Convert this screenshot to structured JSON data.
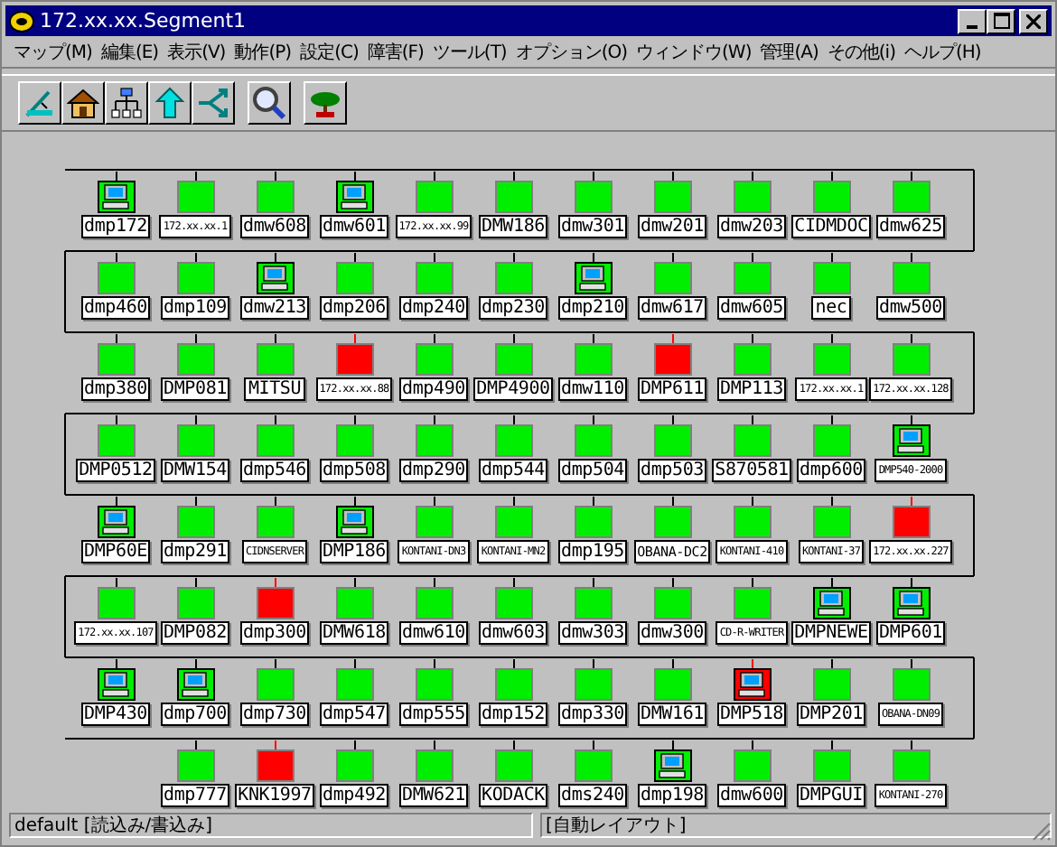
{
  "window": {
    "title": "172.xx.xx.Segment1"
  },
  "menu": [
    "マップ(M)",
    "編集(E)",
    "表示(V)",
    "動作(P)",
    "設定(C)",
    "障害(F)",
    "ツール(T)",
    "オプション(O)",
    "ウィンドウ(W)",
    "管理(A)",
    "その他(i)",
    "ヘルプ(H)"
  ],
  "toolbar": [
    {
      "kind": "draw"
    },
    {
      "kind": "home"
    },
    {
      "kind": "tree"
    },
    {
      "kind": "up"
    },
    {
      "kind": "route"
    },
    {
      "kind": "search",
      "group_gap": true
    },
    {
      "kind": "bonsai",
      "group_gap": true
    }
  ],
  "rows": [
    {
      "nodes": [
        {
          "name": "dmp172",
          "kind": "nt",
          "alarm": false
        },
        {
          "name": "172.xx.xx.1",
          "kind": "plain",
          "alarm": false
        },
        {
          "name": "dmw608",
          "kind": "plain",
          "alarm": false
        },
        {
          "name": "dmw601",
          "kind": "nt",
          "alarm": false
        },
        {
          "name": "172.xx.xx.99",
          "kind": "plain",
          "alarm": false
        },
        {
          "name": "DMW186",
          "kind": "plain",
          "alarm": false
        },
        {
          "name": "dmw301",
          "kind": "plain",
          "alarm": false
        },
        {
          "name": "dmw201",
          "kind": "plain",
          "alarm": false
        },
        {
          "name": "dmw203",
          "kind": "plain",
          "alarm": false
        },
        {
          "name": "CIDMDOC",
          "kind": "plain",
          "alarm": false
        },
        {
          "name": "dmw625",
          "kind": "plain",
          "alarm": false
        }
      ]
    },
    {
      "nodes": [
        {
          "name": "dmp460",
          "kind": "plain",
          "alarm": false
        },
        {
          "name": "dmp109",
          "kind": "plain",
          "alarm": false
        },
        {
          "name": "dmw213",
          "kind": "nt",
          "alarm": false
        },
        {
          "name": "dmp206",
          "kind": "plain",
          "alarm": false
        },
        {
          "name": "dmp240",
          "kind": "plain",
          "alarm": false
        },
        {
          "name": "dmp230",
          "kind": "plain",
          "alarm": false
        },
        {
          "name": "dmp210",
          "kind": "nt",
          "alarm": false
        },
        {
          "name": "dmw617",
          "kind": "plain",
          "alarm": false
        },
        {
          "name": "dmw605",
          "kind": "plain",
          "alarm": false
        },
        {
          "name": "nec",
          "kind": "plain",
          "alarm": false
        },
        {
          "name": "dmw500",
          "kind": "plain",
          "alarm": false
        }
      ]
    },
    {
      "nodes": [
        {
          "name": "dmp380",
          "kind": "plain",
          "alarm": false
        },
        {
          "name": "DMP081",
          "kind": "plain",
          "alarm": false
        },
        {
          "name": "MITSU",
          "kind": "plain",
          "alarm": false
        },
        {
          "name": "172.xx.xx.88",
          "kind": "plain",
          "alarm": true
        },
        {
          "name": "dmp490",
          "kind": "plain",
          "alarm": false
        },
        {
          "name": "DMP4900",
          "kind": "plain",
          "alarm": false
        },
        {
          "name": "dmw110",
          "kind": "plain",
          "alarm": false
        },
        {
          "name": "DMP611",
          "kind": "plain",
          "alarm": true
        },
        {
          "name": "DMP113",
          "kind": "plain",
          "alarm": false
        },
        {
          "name": "172.xx.xx.1",
          "kind": "plain",
          "alarm": false
        },
        {
          "name": "172.xx.xx.128",
          "kind": "plain",
          "alarm": false
        }
      ]
    },
    {
      "nodes": [
        {
          "name": "DMP0512",
          "kind": "plain",
          "alarm": false
        },
        {
          "name": "DMW154",
          "kind": "plain",
          "alarm": false
        },
        {
          "name": "dmp546",
          "kind": "plain",
          "alarm": false
        },
        {
          "name": "dmp508",
          "kind": "plain",
          "alarm": false
        },
        {
          "name": "dmp290",
          "kind": "plain",
          "alarm": false
        },
        {
          "name": "dmp544",
          "kind": "plain",
          "alarm": false
        },
        {
          "name": "dmp504",
          "kind": "plain",
          "alarm": false
        },
        {
          "name": "dmp503",
          "kind": "plain",
          "alarm": false
        },
        {
          "name": "S870581",
          "kind": "plain",
          "alarm": false
        },
        {
          "name": "dmp600",
          "kind": "plain",
          "alarm": false
        },
        {
          "name": "DMP540-2000",
          "kind": "nt",
          "alarm": false
        }
      ]
    },
    {
      "nodes": [
        {
          "name": "DMP60E",
          "kind": "nt",
          "alarm": false
        },
        {
          "name": "dmp291",
          "kind": "plain",
          "alarm": false
        },
        {
          "name": "CIDNSERVER",
          "kind": "plain",
          "alarm": false
        },
        {
          "name": "DMP186",
          "kind": "nt",
          "alarm": false
        },
        {
          "name": "KONTANI-DN3",
          "kind": "plain",
          "alarm": false
        },
        {
          "name": "KONTANI-MN2",
          "kind": "plain",
          "alarm": false
        },
        {
          "name": "dmp195",
          "kind": "plain",
          "alarm": false
        },
        {
          "name": "OBANA-DC2",
          "kind": "plain",
          "alarm": false
        },
        {
          "name": "KONTANI-410",
          "kind": "plain",
          "alarm": false
        },
        {
          "name": "KONTANI-37",
          "kind": "plain",
          "alarm": false
        },
        {
          "name": "172.xx.xx.227",
          "kind": "plain",
          "alarm": true
        }
      ]
    },
    {
      "nodes": [
        {
          "name": "172.xx.xx.107",
          "kind": "plain",
          "alarm": false
        },
        {
          "name": "DMP082",
          "kind": "plain",
          "alarm": false
        },
        {
          "name": "dmp300",
          "kind": "plain",
          "alarm": true
        },
        {
          "name": "DMW618",
          "kind": "plain",
          "alarm": false
        },
        {
          "name": "dmw610",
          "kind": "plain",
          "alarm": false
        },
        {
          "name": "dmw603",
          "kind": "plain",
          "alarm": false
        },
        {
          "name": "dmw303",
          "kind": "plain",
          "alarm": false
        },
        {
          "name": "dmw300",
          "kind": "plain",
          "alarm": false
        },
        {
          "name": "CD-R-WRITER",
          "kind": "plain",
          "alarm": false
        },
        {
          "name": "DMPNEWE",
          "kind": "nt",
          "alarm": false
        },
        {
          "name": "DMP601",
          "kind": "nt",
          "alarm": false
        }
      ]
    },
    {
      "nodes": [
        {
          "name": "DMP430",
          "kind": "nt",
          "alarm": false
        },
        {
          "name": "dmp700",
          "kind": "nt",
          "alarm": false
        },
        {
          "name": "dmp730",
          "kind": "plain",
          "alarm": false
        },
        {
          "name": "dmp547",
          "kind": "plain",
          "alarm": false
        },
        {
          "name": "dmp555",
          "kind": "plain",
          "alarm": false
        },
        {
          "name": "dmp152",
          "kind": "plain",
          "alarm": false
        },
        {
          "name": "dmp330",
          "kind": "plain",
          "alarm": false
        },
        {
          "name": "DMW161",
          "kind": "plain",
          "alarm": false
        },
        {
          "name": "DMP518",
          "kind": "nt",
          "alarm": true
        },
        {
          "name": "DMP201",
          "kind": "plain",
          "alarm": false
        },
        {
          "name": "OBANA-DN09",
          "kind": "plain",
          "alarm": false
        }
      ]
    },
    {
      "nodes": [
        {
          "name": "dmp777",
          "kind": "plain",
          "alarm": false
        },
        {
          "name": "KNK1997",
          "kind": "plain",
          "alarm": true
        },
        {
          "name": "dmp492",
          "kind": "plain",
          "alarm": false
        },
        {
          "name": "DMW621",
          "kind": "plain",
          "alarm": false
        },
        {
          "name": "KODACK",
          "kind": "plain",
          "alarm": false
        },
        {
          "name": "dms240",
          "kind": "plain",
          "alarm": false
        },
        {
          "name": "dmp198",
          "kind": "nt",
          "alarm": false
        },
        {
          "name": "dmw600",
          "kind": "plain",
          "alarm": false
        },
        {
          "name": "DMPGUI",
          "kind": "plain",
          "alarm": false
        },
        {
          "name": "KONTANI-270",
          "kind": "plain",
          "alarm": false
        }
      ]
    }
  ],
  "status_bar": [
    "default [読込み/書込み]",
    "[自動レイアウト]"
  ]
}
